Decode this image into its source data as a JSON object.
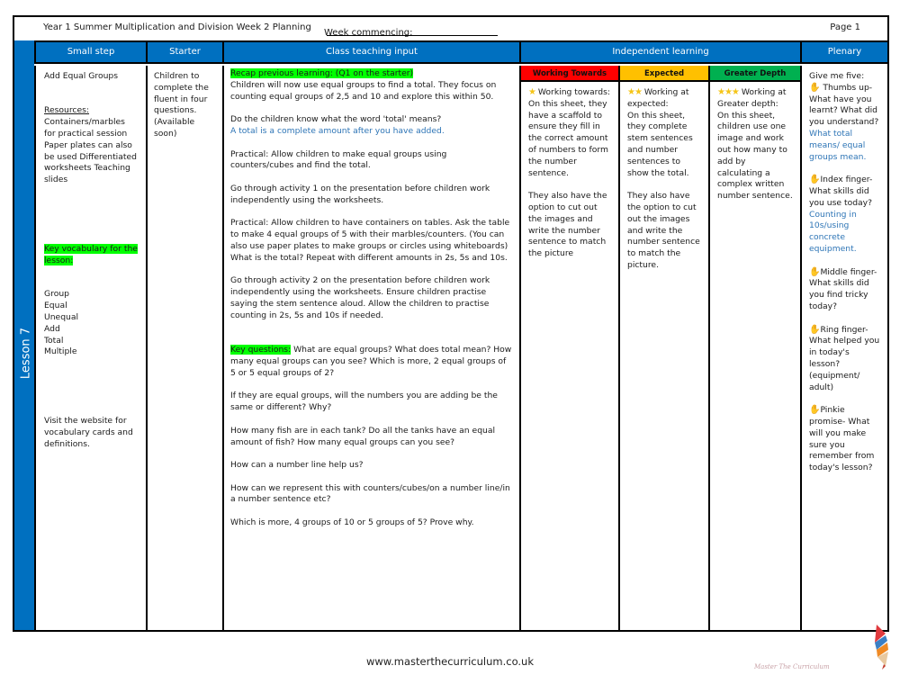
{
  "header": {
    "title": "Year 1 Summer Multiplication and Division Week 2 Planning",
    "week_commencing_label": "Week commencing:",
    "page": "Page 1"
  },
  "columns": {
    "small_step": "Small step",
    "starter": "Starter",
    "class_teaching": "Class teaching input",
    "independent": "Independent learning",
    "plenary": "Plenary",
    "levels": {
      "working_towards": "Working Towards",
      "expected": "Expected",
      "greater_depth": "Greater Depth"
    }
  },
  "lesson_label": "Lesson 7",
  "small_step": {
    "title": "Add Equal Groups",
    "resources_heading": "Resources:",
    "resources": "Containers/marbles for practical session Paper plates can also be used Differentiated worksheets Teaching slides",
    "vocab_heading": "Key vocabulary for the lesson:",
    "vocabulary": [
      "Group",
      "Equal",
      "Unequal",
      "Add",
      "Total",
      "Multiple"
    ],
    "website_note": "Visit the website for vocabulary cards and definitions."
  },
  "starter": {
    "text": "Children to complete the fluent in four questions. (Available soon)"
  },
  "teaching": {
    "recap_heading": "Recap previous learning: (Q1 on the starter)",
    "recap_text": "Children will now use equal groups to find a total. They focus on counting equal groups of 2,5 and 10 and explore this within 50.",
    "total_question": "Do the children know what the word 'total' means?",
    "total_answer": "A total is a complete amount after you have added.",
    "practical1": "Practical: Allow children to make equal groups using counters/cubes and find the total.",
    "activity1": "Go through activity 1 on the presentation before children work independently  using the worksheets.",
    "practical2": "Practical: Allow children to have containers on tables. Ask the table to make 4 equal groups of 5 with their marbles/counters. (You can also use paper plates to make groups or circles using whiteboards) What is the total? Repeat with different amounts in 2s, 5s and 10s.",
    "activity2": "Go through activity 2 on the presentation before children work independently using the worksheets. Ensure children practise saying the stem sentence aloud. Allow the children to practise counting in 2s, 5s and 10s if needed.",
    "key_questions_heading": "Key questions:",
    "key_questions": "What are equal groups? What does total mean? How many equal groups can you see? Which is more, 2 equal groups of 5 or 5 equal groups of 2?",
    "q2": "If they are equal groups, will the numbers you are adding be the same or different? Why?",
    "q3": "How many fish are in each tank? Do all the tanks have an equal amount of fish? How many equal groups can you see?",
    "q4": "How can a number line help us?",
    "q5": "How can we represent this with counters/cubes/on a number line/in a number sentence etc?",
    "q6": "Which is more, 4 groups of 10 or 5 groups of 5? Prove why."
  },
  "independent": {
    "working_towards": {
      "stars": "★",
      "heading": "Working towards:",
      "text": "On this sheet, they have a scaffold to ensure they fill in the correct amount of numbers to form the number sentence.",
      "extra": "They also have the option to cut out the images and write the number sentence to match the picture"
    },
    "expected": {
      "stars": "★★",
      "heading": "Working at expected:",
      "text": "On this sheet, they complete stem sentences and number sentences to show the total.",
      "extra": "They also have the option to cut out the images and write the number sentence to match the picture."
    },
    "greater_depth": {
      "stars": "★★★",
      "heading": "Working at Greater depth:",
      "text": "On this sheet, children use one image and work out how many to add by calculating a complex written number sentence."
    }
  },
  "plenary": {
    "intro": "Give me five:",
    "hand_icon": "✋",
    "thumbs": "Thumbs up- What have you learnt? What did you understand?",
    "thumbs_answer": "What total means/ equal groups mean.",
    "index": "Index finger- What skills did you use today?",
    "index_answer": "Counting in 10s/using concrete equipment.",
    "middle": "Middle finger- What skills did you find tricky today?",
    "ring": "Ring finger- What helped you in today's lesson? (equipment/ adult)",
    "pinkie": "Pinkie promise- What will you make sure you remember from today's lesson?"
  },
  "footer": {
    "url": "www.masterthecurriculum.co.uk",
    "logo_text": "Master The Curriculum"
  },
  "colors": {
    "header_blue": "#0070c0",
    "working_towards": "#ff0000",
    "expected": "#ffc000",
    "greater_depth": "#00b050",
    "highlight": "#00ff00",
    "answer_blue": "#2e75b6"
  }
}
